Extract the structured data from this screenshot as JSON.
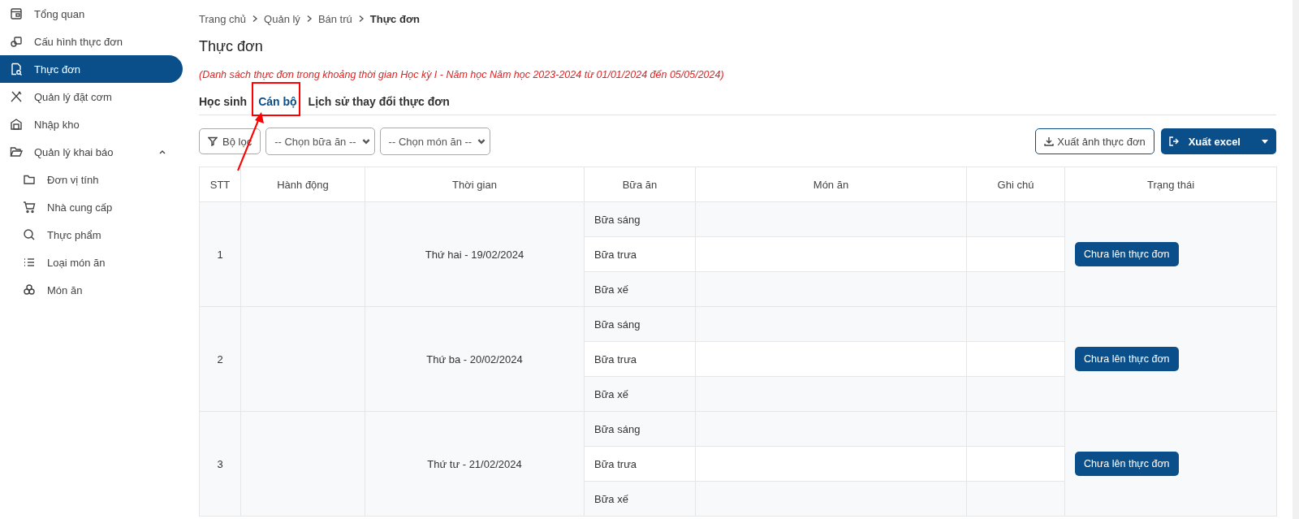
{
  "sidebar": {
    "items": [
      {
        "label": "Tổng quan",
        "selected": false
      },
      {
        "label": "Cấu hình thực đơn",
        "selected": false
      },
      {
        "label": "Thực đơn",
        "selected": true
      },
      {
        "label": "Quản lý đặt cơm",
        "selected": false
      },
      {
        "label": "Nhập kho",
        "selected": false
      },
      {
        "label": "Quản lý khai báo",
        "selected": false,
        "expanded": true,
        "children": [
          {
            "label": "Đơn vị tính",
            "selected": false
          },
          {
            "label": "Nhà cung cấp",
            "selected": false
          },
          {
            "label": "Thực phẩm",
            "selected": false
          },
          {
            "label": "Loại món ăn",
            "selected": false
          },
          {
            "label": "Món ăn",
            "selected": false
          }
        ]
      }
    ]
  },
  "breadcrumb": [
    "Trang chủ",
    "Quản lý",
    "Bán trú",
    "Thực đơn"
  ],
  "page_title": "Thực đơn",
  "note": "(Danh sách thực đơn trong khoảng thời gian Học kỳ I - Năm học Năm học 2023-2024 từ 01/01/2024 đến 05/05/2024)",
  "tabs": [
    {
      "label": "Học sinh",
      "selected": false
    },
    {
      "label": "Cán bộ",
      "selected": true
    },
    {
      "label": "Lịch sử thay đổi thực đơn",
      "selected": false
    }
  ],
  "toolbar": {
    "filter_button": "Bộ lọc",
    "meal_select": "-- Chọn bữa ăn --",
    "dish_select": "-- Chọn món ăn --",
    "export_image_button": "Xuất ảnh thực đơn",
    "export_excel_button": "Xuất excel"
  },
  "table": {
    "columns": [
      "STT",
      "Hành động",
      "Thời gian",
      "Bữa ăn",
      "Món ăn",
      "Ghi chú",
      "Trạng thái"
    ],
    "rows": [
      {
        "stt": "1",
        "time": "Thứ hai - 19/02/2024",
        "meals": [
          "Bữa sáng",
          "Bữa trưa",
          "Bữa xế"
        ],
        "status": "Chưa lên thực đơn"
      },
      {
        "stt": "2",
        "time": "Thứ ba - 20/02/2024",
        "meals": [
          "Bữa sáng",
          "Bữa trưa",
          "Bữa xế"
        ],
        "status": "Chưa lên thực đơn"
      },
      {
        "stt": "3",
        "time": "Thứ tư - 21/02/2024",
        "meals": [
          "Bữa sáng",
          "Bữa trưa",
          "Bữa xế"
        ],
        "status": "Chưa lên thực đơn"
      }
    ]
  }
}
